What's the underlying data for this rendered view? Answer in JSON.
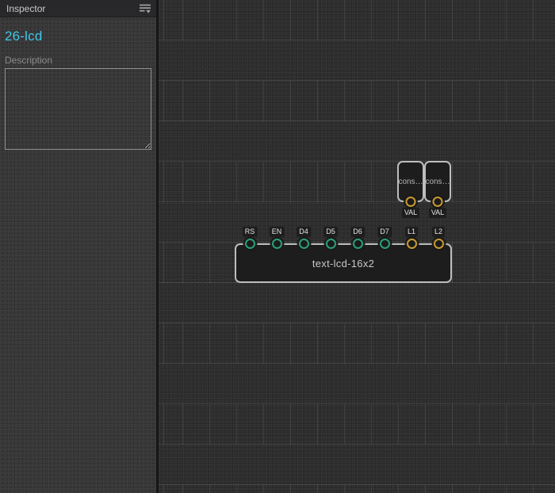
{
  "sidebar": {
    "header": {
      "title": "Inspector",
      "menu_icon": "filter-menu-icon"
    },
    "selection_title": "26-lcd",
    "description": {
      "label": "Description",
      "value": "",
      "placeholder": ""
    }
  },
  "canvas": {
    "nodes": {
      "const1": {
        "label": "cons…",
        "port": {
          "label": "VAL",
          "color": "orange"
        }
      },
      "const2": {
        "label": "cons…",
        "port": {
          "label": "VAL",
          "color": "orange"
        }
      },
      "lcd": {
        "label": "text-lcd-16x2",
        "ports": [
          {
            "label": "RS",
            "color": "green"
          },
          {
            "label": "EN",
            "color": "green"
          },
          {
            "label": "D4",
            "color": "green"
          },
          {
            "label": "D5",
            "color": "green"
          },
          {
            "label": "D6",
            "color": "green"
          },
          {
            "label": "D7",
            "color": "green"
          },
          {
            "label": "L1",
            "color": "orange"
          },
          {
            "label": "L2",
            "color": "orange"
          }
        ]
      }
    }
  },
  "colors": {
    "accent_cyan": "#41c6e8",
    "port_green": "#2b9e78",
    "port_orange": "#c8992f",
    "canvas_bg": "#2b2b2b",
    "sidebar_bg": "#353535",
    "node_bg": "#1d1d1d",
    "node_border": "#bdbdbd"
  }
}
